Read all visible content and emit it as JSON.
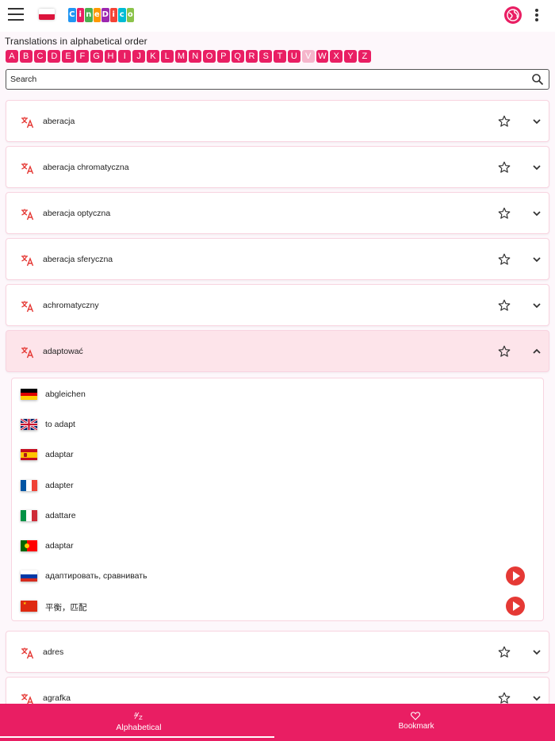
{
  "app": {
    "logo_letters": [
      "C",
      "i",
      "n",
      "e",
      "D",
      "i",
      "c",
      "o"
    ],
    "logo_colors": [
      "#2196f3",
      "#e91e63",
      "#4caf50",
      "#ff9800",
      "#9c27b0",
      "#f44336",
      "#00bcd4",
      "#8bc34a"
    ],
    "accent": "#e91e63"
  },
  "header": {
    "title": "Translations in alphabetical order"
  },
  "alphabet": {
    "letters": [
      "A",
      "B",
      "C",
      "D",
      "E",
      "F",
      "G",
      "H",
      "I",
      "J",
      "K",
      "L",
      "M",
      "N",
      "O",
      "P",
      "Q",
      "R",
      "S",
      "T",
      "U",
      "V",
      "W",
      "X",
      "Y",
      "Z"
    ],
    "disabled": [
      "V"
    ]
  },
  "search": {
    "placeholder": "Search",
    "value": ""
  },
  "terms": [
    {
      "label": "aberacja",
      "expanded": false
    },
    {
      "label": "aberacja chromatyczna",
      "expanded": false
    },
    {
      "label": "aberacja optyczna",
      "expanded": false
    },
    {
      "label": "aberacja sferyczna",
      "expanded": false
    },
    {
      "label": "achromatyczny",
      "expanded": false
    },
    {
      "label": "adaptować",
      "expanded": true
    },
    {
      "label": "adres",
      "expanded": false
    },
    {
      "label": "agrafka",
      "expanded": false
    }
  ],
  "translations": [
    {
      "lang": "de",
      "text": "abgleichen",
      "audio": false
    },
    {
      "lang": "en",
      "text": "to adapt",
      "audio": false
    },
    {
      "lang": "es",
      "text": "adaptar",
      "audio": false
    },
    {
      "lang": "fr",
      "text": "adapter",
      "audio": false
    },
    {
      "lang": "it",
      "text": "adattare",
      "audio": false
    },
    {
      "lang": "pt",
      "text": "adaptar",
      "audio": false
    },
    {
      "lang": "ru",
      "text": "адаптировать, сравнивать",
      "audio": true
    },
    {
      "lang": "zh",
      "text": "平衡，匹配",
      "audio": true
    }
  ],
  "bottom_nav": {
    "alphabetical": "Alphabetical",
    "alphabetical_icon": "A→Z",
    "bookmark": "Bookmark"
  }
}
